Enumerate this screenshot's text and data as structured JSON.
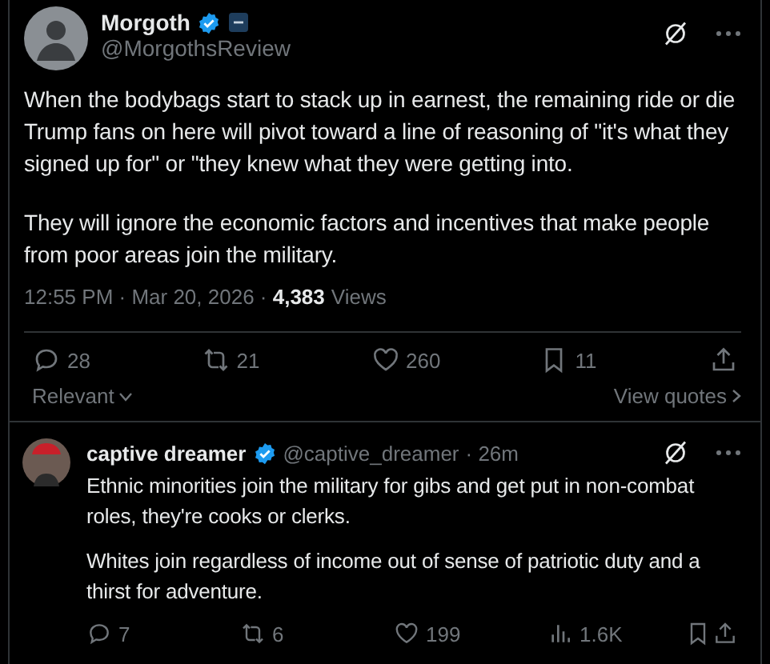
{
  "post": {
    "author": {
      "name": "Morgoth",
      "handle": "@MorgothsReview",
      "verified": true,
      "affiliate_badge": true
    },
    "paragraphs": [
      "When the bodybags start to stack up in earnest, the remaining ride or die Trump fans on here will pivot toward a line of reasoning of \"it's what they signed up for\" or \"they knew what they were getting into.",
      "They will ignore the economic factors and incentives that make people from poor areas join the military."
    ],
    "timestamp": "12:55 PM · Mar 20, 2026 · ",
    "views_count": "4,383",
    "views_label": "Views",
    "actions": [
      {
        "kind": "reply",
        "count": "28"
      },
      {
        "kind": "repost",
        "count": "21"
      },
      {
        "kind": "like",
        "count": "260"
      },
      {
        "kind": "bookmark",
        "count": "11"
      },
      {
        "kind": "share"
      }
    ],
    "sort": "Relevant",
    "quotes_link": "View quotes"
  },
  "reply": {
    "author": {
      "name": "captive dreamer",
      "handle": "@captive_dreamer",
      "verified": true
    },
    "time": "· 26m",
    "paragraphs": [
      "Ethnic minorities join the military for gibs and get put in non-combat roles, they're cooks or clerks.",
      "Whites join regardless of income out of sense of patriotic duty and a thirst for adventure."
    ],
    "actions": [
      {
        "kind": "reply",
        "count": "7"
      },
      {
        "kind": "repost",
        "count": "6"
      },
      {
        "kind": "like",
        "count": "199"
      },
      {
        "kind": "views",
        "count": "1.6K"
      },
      {
        "kind": "bookmark"
      },
      {
        "kind": "share"
      }
    ]
  }
}
